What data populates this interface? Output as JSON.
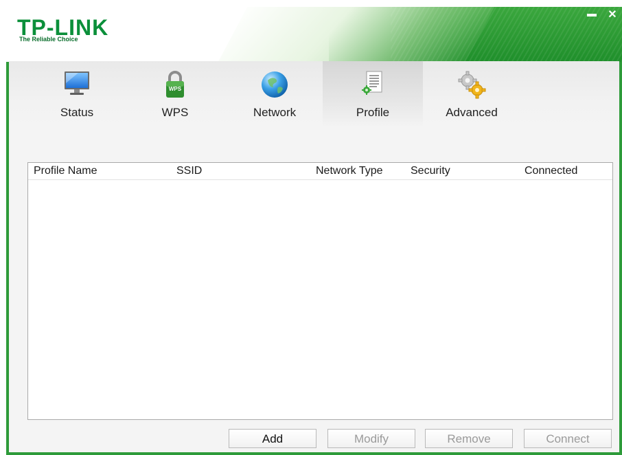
{
  "header": {
    "brand": "TP-LINK",
    "tagline": "The Reliable Choice",
    "minimize_label": "—",
    "close_label": "✕"
  },
  "tabs": [
    {
      "label": "Status",
      "icon": "monitor-icon",
      "active": false
    },
    {
      "label": "WPS",
      "icon": "wps-lock-icon",
      "active": false
    },
    {
      "label": "Network",
      "icon": "globe-icon",
      "active": false
    },
    {
      "label": "Profile",
      "icon": "profile-document-icon",
      "active": true
    },
    {
      "label": "Advanced",
      "icon": "gears-icon",
      "active": false
    }
  ],
  "table": {
    "columns": [
      "Profile Name",
      "SSID",
      "Network Type",
      "Security",
      "Connected"
    ],
    "rows": []
  },
  "buttons": {
    "add": "Add",
    "modify": "Modify",
    "remove": "Remove",
    "connect": "Connect"
  },
  "colors": {
    "brand_green": "#0b8f3a",
    "header_green": "#2e9b3a"
  }
}
